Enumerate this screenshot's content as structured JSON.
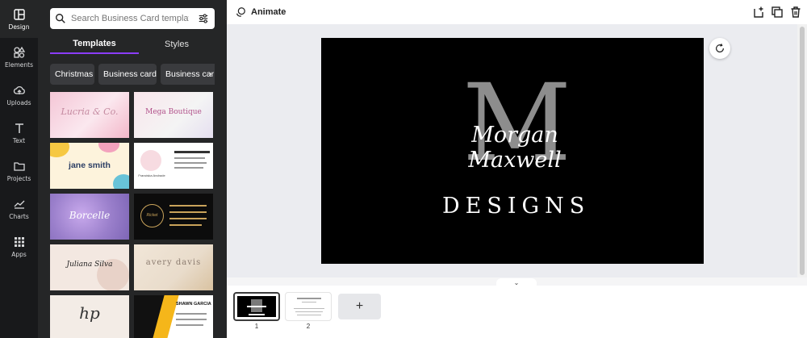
{
  "rail": {
    "items": [
      {
        "label": "Design",
        "icon": "design-layout-icon"
      },
      {
        "label": "Elements",
        "icon": "elements-shapes-icon"
      },
      {
        "label": "Uploads",
        "icon": "cloud-upload-icon"
      },
      {
        "label": "Text",
        "icon": "text-t-icon"
      },
      {
        "label": "Projects",
        "icon": "folder-icon"
      },
      {
        "label": "Charts",
        "icon": "line-chart-icon"
      },
      {
        "label": "Apps",
        "icon": "apps-grid-icon"
      }
    ]
  },
  "panel": {
    "search_placeholder": "Search Business Card templates",
    "tabs": [
      "Templates",
      "Styles"
    ],
    "chips": [
      "Christmas",
      "Business card",
      "Business car"
    ],
    "templates": [
      {
        "text": "Lucria & Co.",
        "bg": "#f7dbe5"
      },
      {
        "text": "Mega Boutique",
        "bg": "#f6eef0"
      },
      {
        "text": "jane smith",
        "bg": "#fdf1d8"
      },
      {
        "text": "Franciska Andrade",
        "bg": "#ffffff"
      },
      {
        "text": "Borcelle",
        "bg": "#9a80c7"
      },
      {
        "text": "Ricket",
        "bg": "#0c0c0c"
      },
      {
        "text": "Juliana Silva",
        "bg": "#f2e7e0"
      },
      {
        "text": "avery davis",
        "bg": "#efe5d8"
      },
      {
        "text": "hp",
        "bg": "#f3ece6"
      },
      {
        "text": "SHAWN GARCIA",
        "bg": "#ffffff"
      }
    ]
  },
  "toolbar": {
    "animate_label": "Animate"
  },
  "design": {
    "monogram": "M",
    "name": "Morgan Maxwell",
    "word": "DESIGNS"
  },
  "pages": {
    "numbers": [
      "1",
      "2"
    ],
    "add_label": "+"
  },
  "colors": {
    "accent": "#8b3dff",
    "rail_bg": "#18191b",
    "panel_bg": "#252627"
  }
}
